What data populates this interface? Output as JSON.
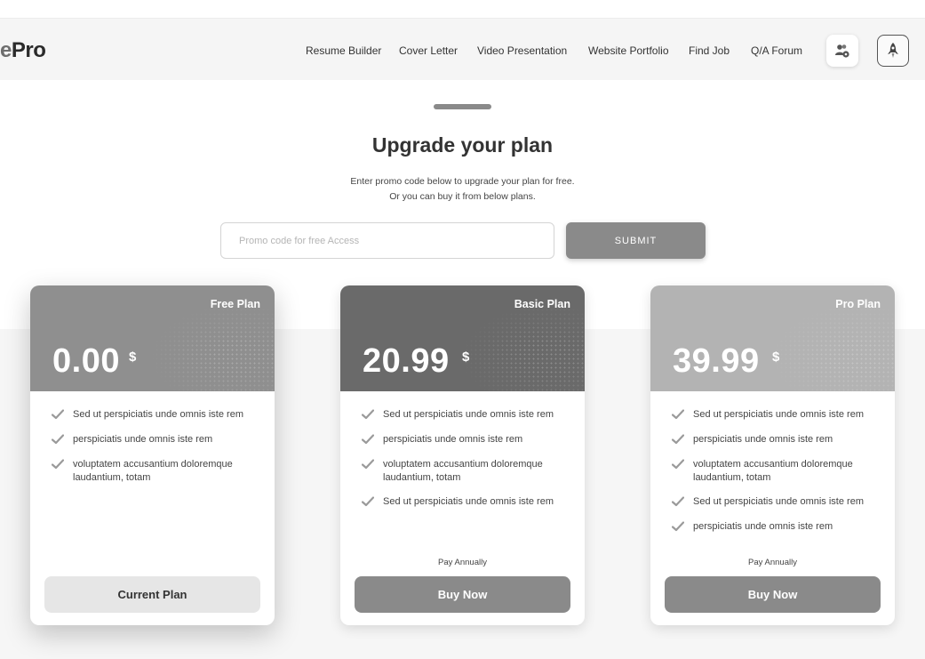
{
  "brand": {
    "prefix": "e",
    "name": "Pro"
  },
  "nav": {
    "links": [
      "Resume Builder",
      "Cover Letter",
      "Video Presentation",
      "Website Portfolio",
      "Find Job",
      "Q/A Forum"
    ],
    "icons": [
      "users-settings-icon",
      "rocket-icon"
    ]
  },
  "header": {
    "title": "Upgrade your plan",
    "subtitle_line1": "Enter promo code below to upgrade your plan for free.",
    "subtitle_line2": "Or you can buy it from below plans."
  },
  "promo": {
    "placeholder": "Promo code for free Access",
    "value": "",
    "submit_label": "SUBMIT"
  },
  "plans": [
    {
      "name": "Free Plan",
      "price": "0.00",
      "currency": "$",
      "header_color": "#8f8f8f",
      "features": [
        "Sed ut perspiciatis unde omnis iste rem",
        "perspiciatis unde omnis iste rem",
        "voluptatem accusantium doloremque laudantium, totam"
      ],
      "billing": "",
      "button_label": "Current Plan"
    },
    {
      "name": "Basic Plan",
      "price": "20.99",
      "currency": "$",
      "header_color": "#6a6a6a",
      "features": [
        "Sed ut perspiciatis unde omnis iste rem",
        "perspiciatis unde omnis iste rem",
        "voluptatem accusantium doloremque laudantium, totam",
        "Sed ut perspiciatis unde omnis iste rem"
      ],
      "billing": "Pay Annually",
      "button_label": "Buy Now"
    },
    {
      "name": "Pro Plan",
      "price": "39.99",
      "currency": "$",
      "header_color": "#b3b3b3",
      "features": [
        "Sed ut perspiciatis unde omnis iste rem",
        "perspiciatis unde omnis iste rem",
        "voluptatem accusantium doloremque laudantium, totam",
        "Sed ut perspiciatis unde omnis iste rem",
        "perspiciatis unde omnis iste rem"
      ],
      "billing": "Pay Annually",
      "button_label": "Buy Now"
    }
  ],
  "colors": {
    "accent_button": "#8a8a8a",
    "current_button": "#e6e6e6",
    "check": "#9a9a9a"
  }
}
